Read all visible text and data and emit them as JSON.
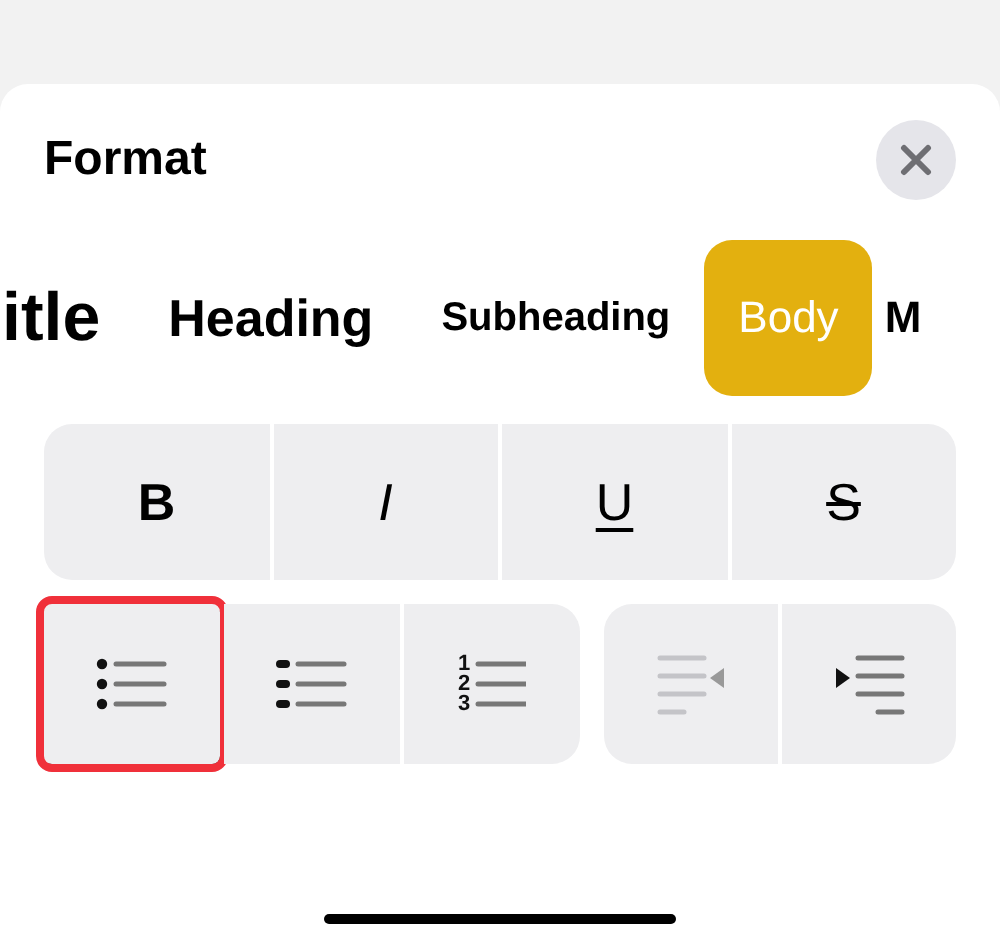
{
  "sheet": {
    "title": "Format"
  },
  "styles": [
    {
      "label": "itle",
      "kind": "title",
      "selected": false
    },
    {
      "label": "Heading",
      "kind": "heading",
      "selected": false
    },
    {
      "label": "Subheading",
      "kind": "subheading",
      "selected": false
    },
    {
      "label": "Body",
      "kind": "body",
      "selected": true
    },
    {
      "label": "M",
      "kind": "mono",
      "selected": false
    }
  ],
  "text_formats": [
    {
      "label": "B",
      "kind": "bold"
    },
    {
      "label": "I",
      "kind": "italic"
    },
    {
      "label": "U",
      "kind": "underline"
    },
    {
      "label": "S",
      "kind": "strike"
    }
  ],
  "list_buttons": [
    {
      "kind": "bulleted",
      "highlighted": true
    },
    {
      "kind": "dashed",
      "highlighted": false
    },
    {
      "kind": "numbered",
      "highlighted": false,
      "numbers": [
        "1",
        "2",
        "3"
      ]
    }
  ],
  "indent_buttons": [
    {
      "kind": "outdent",
      "disabled": true
    },
    {
      "kind": "indent",
      "disabled": false
    }
  ]
}
